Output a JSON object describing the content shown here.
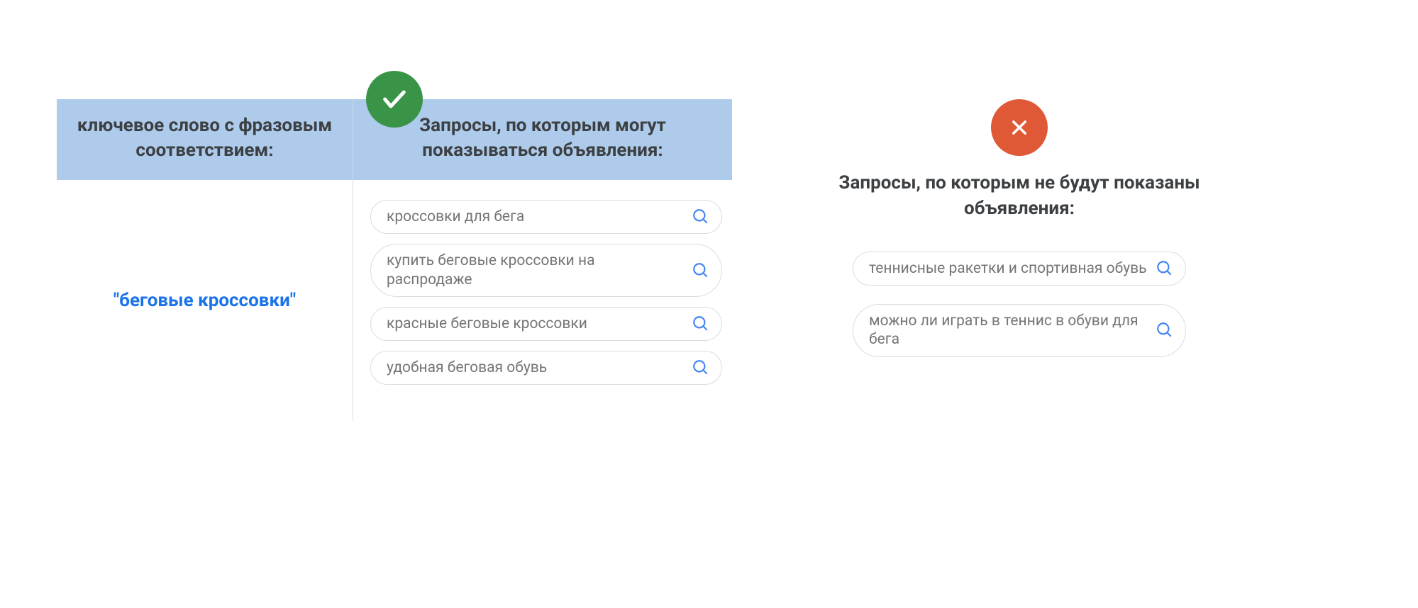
{
  "left": {
    "header_keyword": "ключевое слово с фразовым соответствием:",
    "header_matches": "Запросы, по которым могут показываться объявления:",
    "keyword": "\"беговые кроссовки\"",
    "matches": [
      "кроссовки для бега",
      "купить беговые кроссовки на распродаже",
      "красные беговые кроссовки",
      "удобная беговая обувь"
    ]
  },
  "right": {
    "header": "Запросы, по которым не будут показаны объявления:",
    "nonmatches": [
      "теннисные ракетки и спортивная обувь",
      "можно ли играть в теннис в обуви для бега"
    ]
  },
  "icons": {
    "check": "check-icon",
    "x": "x-icon",
    "search": "search-icon"
  },
  "colors": {
    "green": "#3a9447",
    "red": "#df5936",
    "header_bg": "#aecbeb",
    "keyword_blue": "#1a73e8",
    "search_blue": "#4285f4",
    "text_gray": "#757575",
    "heading_gray": "#3c4043"
  }
}
